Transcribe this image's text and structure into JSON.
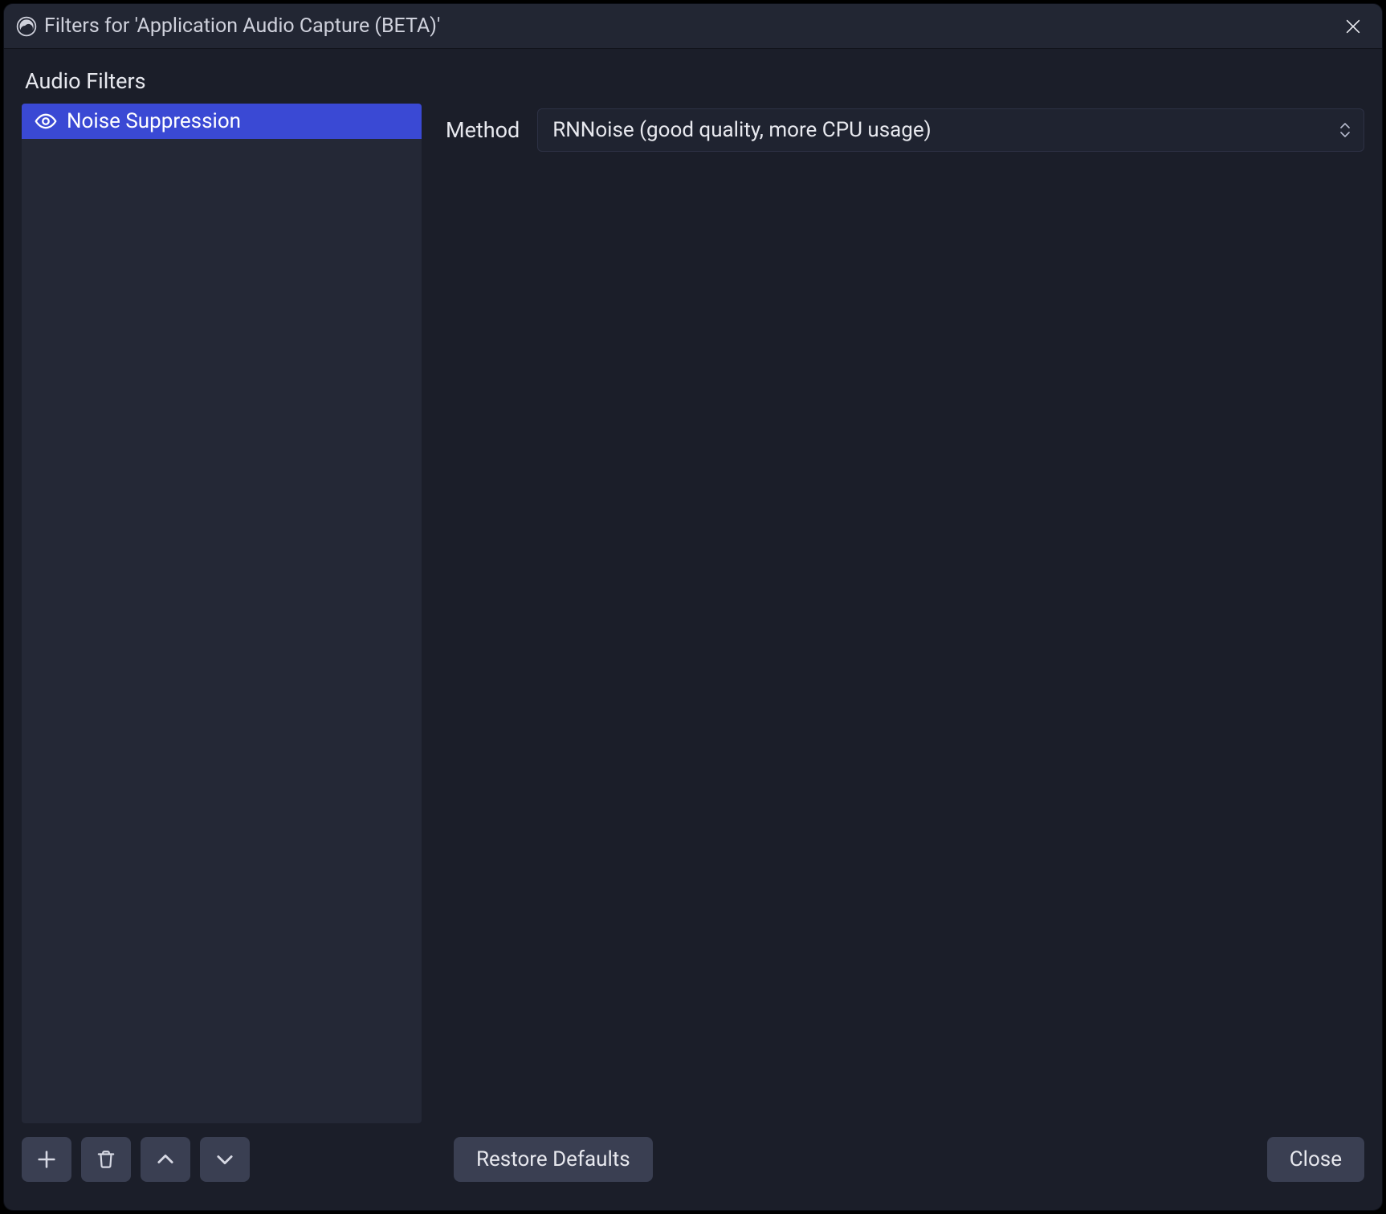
{
  "titlebar": {
    "title": "Filters for 'Application Audio Capture (BETA)'"
  },
  "section": {
    "label": "Audio Filters"
  },
  "filters": [
    {
      "name": "Noise Suppression",
      "visible": true,
      "selected": true
    }
  ],
  "settings": {
    "method": {
      "label": "Method",
      "value": "RNNoise (good quality, more CPU usage)"
    }
  },
  "footer": {
    "restore_defaults": "Restore Defaults",
    "close": "Close"
  }
}
